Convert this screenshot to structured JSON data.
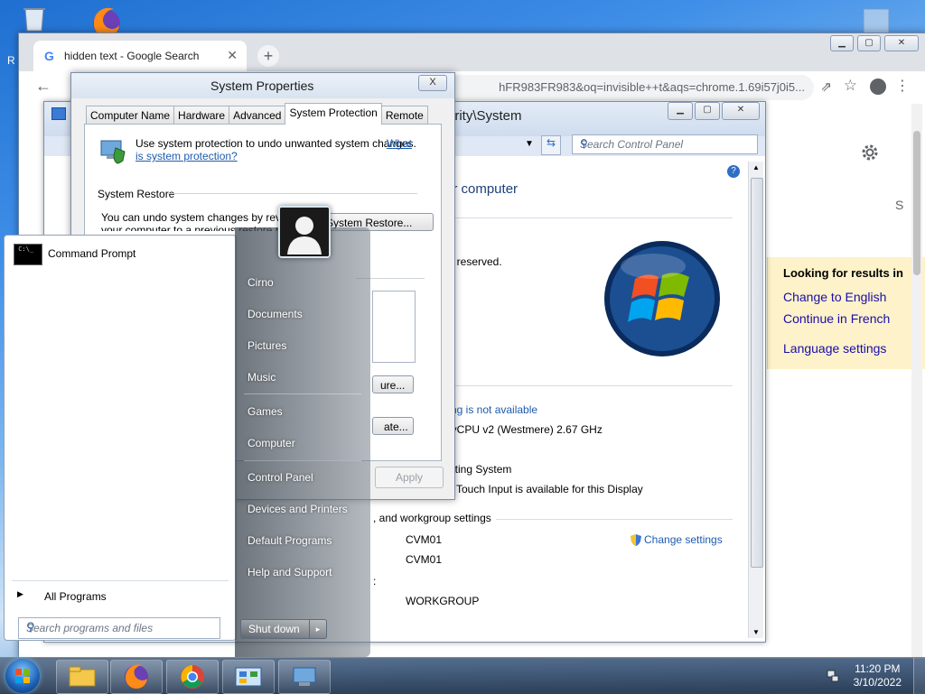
{
  "desktop": {
    "recycle_bin_label": "R",
    "icon_names": [
      "recycle-bin-icon",
      "firefox-icon"
    ]
  },
  "chrome": {
    "tab_title": "hidden text - Google Search",
    "url_fragment": "hFR983FR983&oq=invisible++t&aqs=chrome.1.69i57j0i5...",
    "new_tab_label": "+",
    "letter_s": "S",
    "lang_box": {
      "heading": "Looking for results in",
      "change_english": "Change to English",
      "continue_french": "Continue in French",
      "language_settings": "Language settings"
    }
  },
  "control_panel": {
    "path": "urity\\System",
    "search_placeholder": "Search Control Panel",
    "heading_computer": "ur computer",
    "rights_reserved": "ts reserved.",
    "rating_link": "ting is not available",
    "processor": "nyCPU v2 (Westmere)   2.67 GHz",
    "os_type": "rating System",
    "pen_touch": "Touch Input is available for this Display",
    "section_workgroup": ", and workgroup settings",
    "computer_name": "CVM01",
    "full_computer_name": "CVM01",
    "workgroup": "WORKGROUP",
    "change_settings": "Change settings",
    "colon": ":"
  },
  "system_properties": {
    "title": "System Properties",
    "close_label": "X",
    "tabs": [
      "Computer Name",
      "Hardware",
      "Advanced",
      "System Protection",
      "Remote"
    ],
    "active_tab": "System Protection",
    "intro_text": "Use system protection to undo unwanted system changes.",
    "intro_link_1": "What",
    "intro_link_2": "is system protection?",
    "section_restore": "System Restore",
    "restore_text_1": "You can undo system changes by revertin",
    "restore_text_2": "your computer to a previous restore point",
    "restore_button": "System Restore...",
    "configure_button_fragment": "ure...",
    "create_button_fragment": "ate...",
    "apply_button": "Apply"
  },
  "start_menu": {
    "pinned": [
      {
        "label": "Command Prompt"
      }
    ],
    "all_programs": "All Programs",
    "search_placeholder": "Search programs and files",
    "right_items": [
      "Cirno",
      "Documents",
      "Pictures",
      "Music",
      "Games",
      "Computer",
      "Control Panel",
      "Devices and Printers",
      "Default Programs",
      "Help and Support"
    ],
    "shutdown_label": "Shut down",
    "shutdown_arrow": "▸"
  },
  "taskbar": {
    "buttons": [
      "explorer-icon",
      "firefox-icon",
      "chrome-icon",
      "control-panel-icon",
      "system-properties-icon"
    ],
    "time": "11:20 PM",
    "date": "3/10/2022"
  },
  "colors": {
    "link_blue": "#1f5bad",
    "google_link": "#1a0dab",
    "lang_box_bg": "#fdf2c9"
  }
}
